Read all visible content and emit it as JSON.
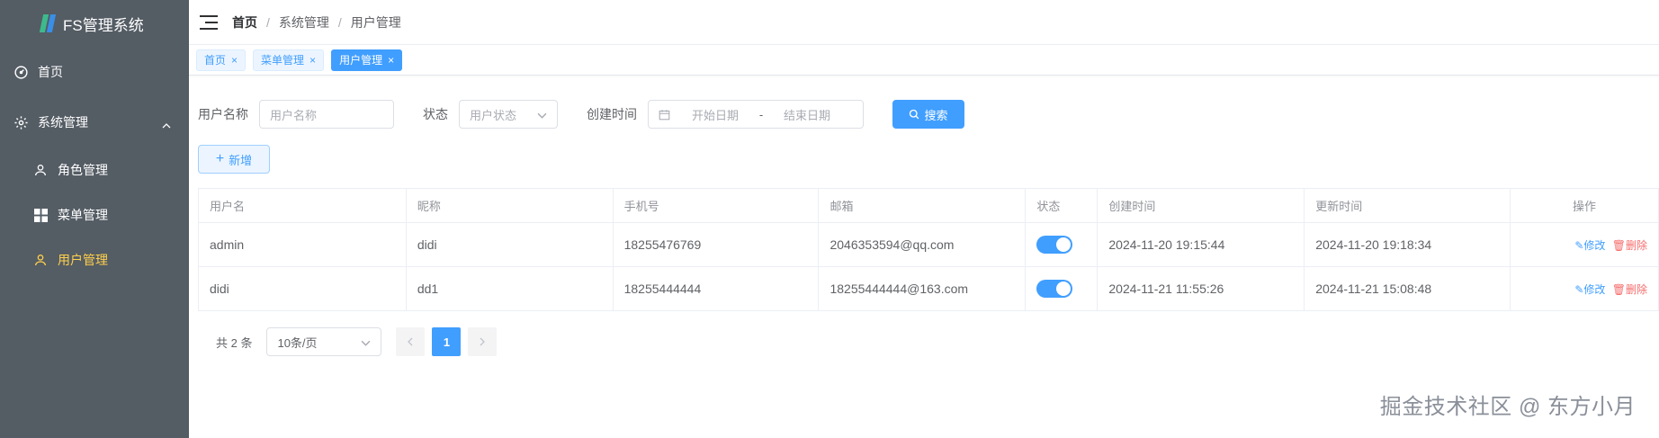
{
  "app": {
    "title": "FS管理系统"
  },
  "sidebar": {
    "items": [
      {
        "label": "首页"
      },
      {
        "label": "系统管理"
      },
      {
        "label": "角色管理"
      },
      {
        "label": "菜单管理"
      },
      {
        "label": "用户管理"
      }
    ]
  },
  "breadcrumb": [
    "首页",
    "系统管理",
    "用户管理"
  ],
  "tabs": [
    "首页",
    "菜单管理",
    "用户管理"
  ],
  "search": {
    "username_label": "用户名称",
    "username_placeholder": "用户名称",
    "status_label": "状态",
    "status_placeholder": "用户状态",
    "created_label": "创建时间",
    "start_placeholder": "开始日期",
    "range_sep": "-",
    "end_placeholder": "结束日期",
    "search_button": "搜索"
  },
  "add_button": "新增",
  "table": {
    "headers": [
      "用户名",
      "昵称",
      "手机号",
      "邮箱",
      "状态",
      "创建时间",
      "更新时间",
      "操作"
    ],
    "rows": [
      {
        "username": "admin",
        "nickname": "didi",
        "phone": "18255476769",
        "email": "2046353594@qq.com",
        "status": true,
        "created": "2024-11-20 19:15:44",
        "updated": "2024-11-20 19:18:34"
      },
      {
        "username": "didi",
        "nickname": "dd1",
        "phone": "18255444444",
        "email": "18255444444@163.com",
        "status": true,
        "created": "2024-11-21 11:55:26",
        "updated": "2024-11-21 15:08:48"
      }
    ],
    "edit_label": "修改",
    "delete_label": "删除"
  },
  "pagination": {
    "total": "共 2 条",
    "page_size": "10条/页",
    "current": "1"
  },
  "watermark": "掘金技术社区 @ 东方小月",
  "colors": {
    "primary": "#409eff",
    "sidebar_bg": "#545c64",
    "active_menu": "#ffd04b",
    "danger": "#f56c6c"
  }
}
